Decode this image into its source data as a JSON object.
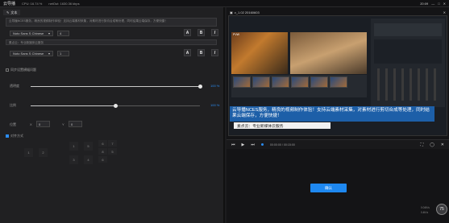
{
  "topbar": {
    "app_title": "云导播",
    "cpu": "CPU: 16.74 %",
    "net": "netOut: 1630.36 kbps",
    "time": "20:09"
  },
  "editor": {
    "tab_label": "文本",
    "text_placeholder": "云导播NCES服务，精良的视频制作体验！支持云端素材采集，对素材进行剪切合成等处理，同时结果云端保存，方便快捷！",
    "font1": "Noto Sans S Chinese",
    "size1": "4",
    "text2_placeholder": "素点云：专业新媒体云服务",
    "font2": "Noto Sans S Chinese",
    "size2": "1",
    "bg_label": "同步设置横幅问题",
    "opacity_label": "透明度",
    "opacity_value": "100 %",
    "opacity_fraction": 1.0,
    "scale_label": "比例",
    "scale_value": "100 %",
    "scale_fraction": 0.5,
    "position_label": "位置",
    "x_label": "X",
    "x_value": "0",
    "y_label": "Y",
    "y_value": "0",
    "anchor_label": "对齐方式",
    "grid_row1": [
      "",
      "1",
      "",
      "5",
      "",
      "6",
      "7",
      "8"
    ],
    "grid_row2": [
      "1",
      "2",
      "",
      "3",
      "4",
      "",
      "5",
      "6"
    ]
  },
  "preview": {
    "version": "v_1.02 20160603",
    "inner_logo": "PVW",
    "caption_text": "云导播NCES服务，精良的视频制作体验！支持云端素材采集，对素材进行剪切合成等处理，同时结果云端保存，方便快捷！",
    "lower_third": "素点云：专业新媒体云服务"
  },
  "controls": {
    "timecode": "00:00:00 / 00:15:00"
  },
  "confirm_label": "确认",
  "perf": {
    "percent": "75",
    "upload": "0.04K/s",
    "download": "0.4K/s"
  }
}
